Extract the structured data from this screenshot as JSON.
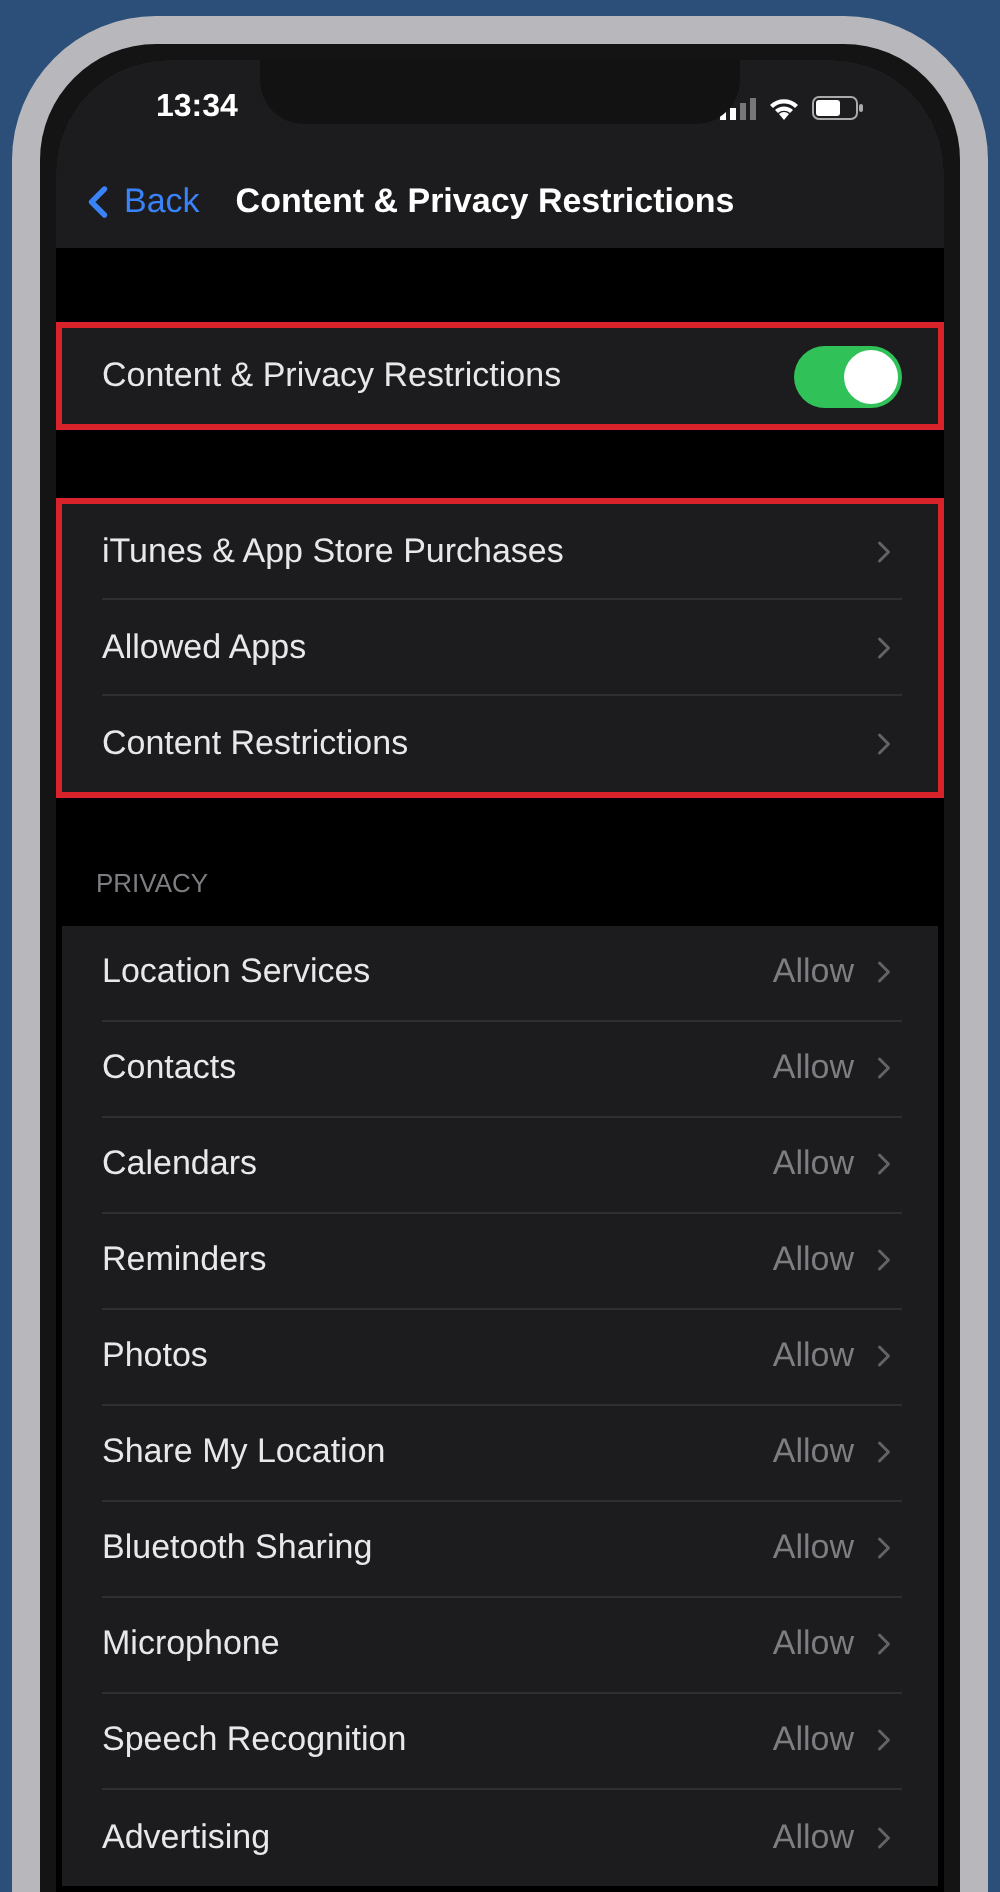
{
  "status_bar": {
    "time": "13:34"
  },
  "nav": {
    "back": "Back",
    "title": "Content & Privacy Restrictions"
  },
  "groups": [
    {
      "highlighted": true,
      "rows": [
        {
          "kind": "toggle",
          "label": "Content & Privacy Restrictions",
          "on": true
        }
      ]
    },
    {
      "highlighted": true,
      "rows": [
        {
          "kind": "link",
          "label": "iTunes & App Store Purchases"
        },
        {
          "kind": "link",
          "label": "Allowed Apps"
        },
        {
          "kind": "link",
          "label": "Content Restrictions"
        }
      ]
    },
    {
      "header": "PRIVACY",
      "highlighted": false,
      "rows": [
        {
          "kind": "link",
          "label": "Location Services",
          "value": "Allow"
        },
        {
          "kind": "link",
          "label": "Contacts",
          "value": "Allow"
        },
        {
          "kind": "link",
          "label": "Calendars",
          "value": "Allow"
        },
        {
          "kind": "link",
          "label": "Reminders",
          "value": "Allow"
        },
        {
          "kind": "link",
          "label": "Photos",
          "value": "Allow"
        },
        {
          "kind": "link",
          "label": "Share My Location",
          "value": "Allow"
        },
        {
          "kind": "link",
          "label": "Bluetooth Sharing",
          "value": "Allow"
        },
        {
          "kind": "link",
          "label": "Microphone",
          "value": "Allow"
        },
        {
          "kind": "link",
          "label": "Speech Recognition",
          "value": "Allow"
        },
        {
          "kind": "link",
          "label": "Advertising",
          "value": "Allow"
        }
      ]
    }
  ]
}
